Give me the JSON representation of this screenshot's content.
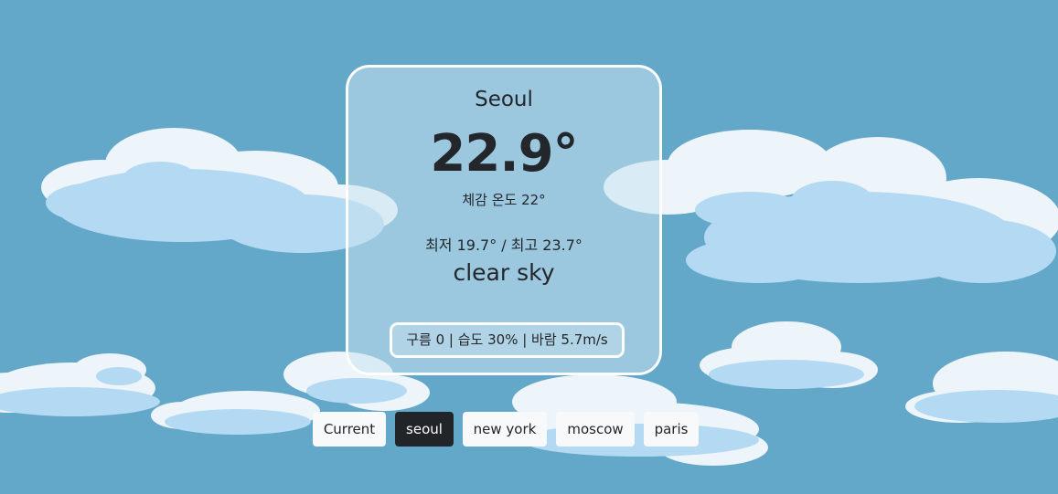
{
  "weather": {
    "city": "Seoul",
    "temperature": "22.9°",
    "feels_like": "체감 온도 22°",
    "min_max": "최저 19.7° / 최고 23.7°",
    "description": "clear sky",
    "details": "구름 0 | 습도 30% | 바람 5.7m/s"
  },
  "city_buttons": [
    {
      "label": "Current",
      "active": false
    },
    {
      "label": "seoul",
      "active": true
    },
    {
      "label": "new york",
      "active": false
    },
    {
      "label": "moscow",
      "active": false
    },
    {
      "label": "paris",
      "active": false
    }
  ],
  "colors": {
    "sky": "#64a8c9",
    "cloud_light": "#edf5fa",
    "cloud_shade": "#b3daf2",
    "active_button": "#212529",
    "button": "#f8f9fa"
  }
}
